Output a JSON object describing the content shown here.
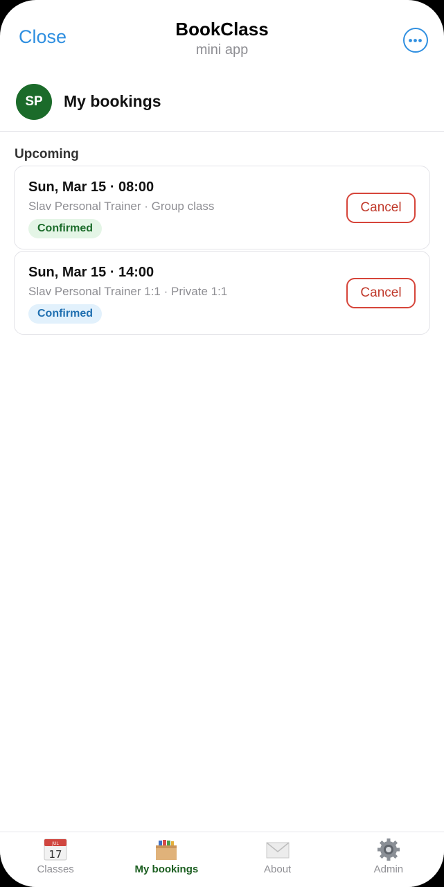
{
  "topbar": {
    "close_label": "Close",
    "title": "BookClass",
    "subtitle": "mini app",
    "accent_color": "#2f8fe0",
    "more_icon": "more-horizontal-icon"
  },
  "header": {
    "avatar_initials": "SP",
    "avatar_color": "#1b6b2a",
    "title": "My bookings"
  },
  "section": {
    "title": "Upcoming"
  },
  "bookings": [
    {
      "datetime": "Sun, Mar 15 · 08:00",
      "meta": "Slav Personal Trainer · Group class",
      "status": "Confirmed",
      "status_color": "#1b6b2a",
      "cancel_label": "Cancel"
    },
    {
      "datetime": "Sun, Mar 15 · 14:00",
      "meta": "Slav Personal Trainer 1:1 · Private 1:1",
      "status": "Confirmed",
      "status_color": "#1f6fb0",
      "cancel_label": "Cancel"
    }
  ],
  "tabbar": {
    "active_color": "#1b5e20",
    "tabs": [
      {
        "label": "Classes",
        "icon": "calendar-icon",
        "calendar_month": "JUL",
        "calendar_day": "17",
        "active": false
      },
      {
        "label": "My bookings",
        "icon": "card-box-icon",
        "active": true
      },
      {
        "label": "About",
        "icon": "envelope-icon",
        "active": false
      },
      {
        "label": "Admin",
        "icon": "gear-icon",
        "active": false
      }
    ]
  }
}
